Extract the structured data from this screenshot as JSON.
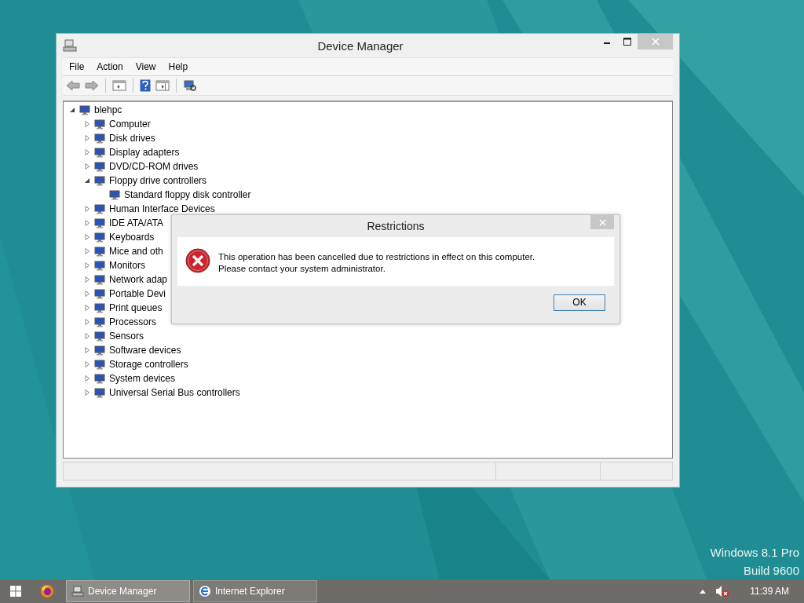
{
  "desktop": {
    "watermark": [
      "Windows 8.1 Pro",
      "Build 9600"
    ]
  },
  "window": {
    "title": "Device Manager",
    "menu": [
      "File",
      "Action",
      "View",
      "Help"
    ],
    "tree": {
      "label": "blehpc",
      "expanded": true,
      "children": [
        {
          "label": "Computer",
          "expanded": false
        },
        {
          "label": "Disk drives",
          "expanded": false
        },
        {
          "label": "Display adapters",
          "expanded": false
        },
        {
          "label": "DVD/CD-ROM drives",
          "expanded": false
        },
        {
          "label": "Floppy drive controllers",
          "expanded": true,
          "children": [
            {
              "label": "Standard floppy disk controller"
            }
          ]
        },
        {
          "label": "Human Interface Devices",
          "expanded": false
        },
        {
          "label": "IDE ATA/ATA",
          "expanded": false
        },
        {
          "label": "Keyboards",
          "expanded": false
        },
        {
          "label": "Mice and oth",
          "expanded": false
        },
        {
          "label": "Monitors",
          "expanded": false
        },
        {
          "label": "Network adap",
          "expanded": false
        },
        {
          "label": "Portable Devi",
          "expanded": false
        },
        {
          "label": "Print queues",
          "expanded": false
        },
        {
          "label": "Processors",
          "expanded": false
        },
        {
          "label": "Sensors",
          "expanded": false
        },
        {
          "label": "Software devices",
          "expanded": false
        },
        {
          "label": "Storage controllers",
          "expanded": false
        },
        {
          "label": "System devices",
          "expanded": false
        },
        {
          "label": "Universal Serial Bus controllers",
          "expanded": false
        }
      ]
    }
  },
  "dialog": {
    "title": "Restrictions",
    "message": "This operation has been cancelled due to restrictions in effect on this computer. Please contact your system administrator.",
    "buttons": [
      "OK"
    ]
  },
  "taskbar": {
    "apps": [
      {
        "label": "Device Manager",
        "selected": true
      },
      {
        "label": "Internet Explorer",
        "selected": false
      }
    ],
    "clock": "11:39 AM"
  }
}
